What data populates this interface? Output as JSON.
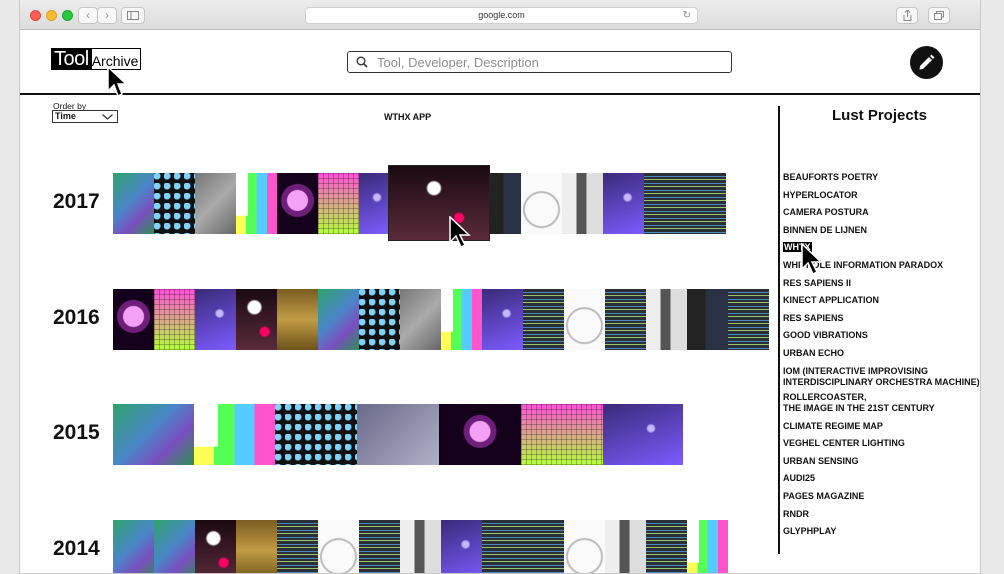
{
  "browser": {
    "address": "google.com"
  },
  "header": {
    "logo_tool": "Tool",
    "logo_archive": "Archive",
    "search_placeholder": "Tool, Developer, Description"
  },
  "controls": {
    "order_by_label": "Order by",
    "order_by_value": "Time",
    "selected_project": "WTHX APP"
  },
  "timeline": {
    "years": [
      "2017",
      "2016",
      "2015",
      "2014"
    ]
  },
  "sidebar": {
    "title": "Lust Projects",
    "projects": [
      "BEAUFORTS POETRY",
      "HYPERLOCATOR",
      "CAMERA POSTURA",
      "BINNEN DE LIJNEN",
      "WHTX",
      "WHITHOLE INFORMATION PARADOX",
      "RES SAPIENS II",
      "KINECT APPLICATION",
      "RES SAPIENS",
      "GOOD VIBRATIONS",
      "URBAN ECHO",
      "IOM (INTERACTIVE IMPROVISING\nINTERDISCIPLINARY ORCHESTRA MACHINE)",
      "ROLLERCOASTER,\nTHE IMAGE IN THE 21ST CENTURY",
      "CLIMATE REGIME MAP",
      "VEGHEL CENTER LIGHTING",
      "URBAN SENSING",
      "AUDI25",
      "PAGES MAGAZINE",
      "RNDR",
      "GLYPHPLAY"
    ],
    "active_index": 4
  },
  "icons": {
    "search": "search-icon",
    "edit": "pencil-icon",
    "cursor": "arrow-cursor-icon"
  }
}
